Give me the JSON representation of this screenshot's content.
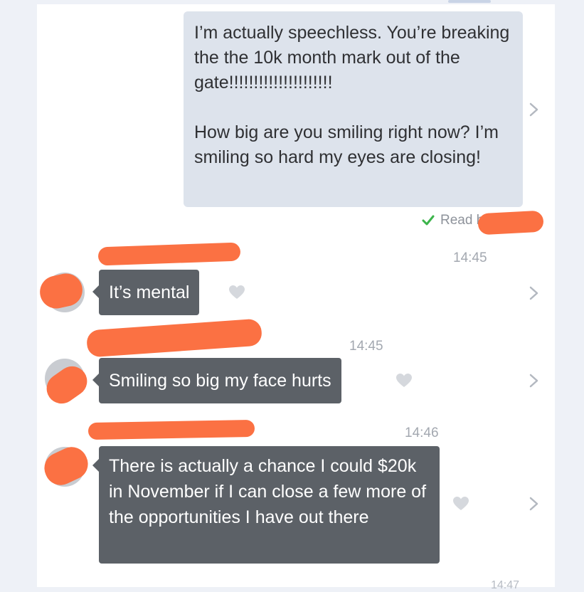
{
  "messages": {
    "outgoing": {
      "text": "I’m actually speechless. You’re breaking  the the 10k month mark out of the gate!!!!!!!!!!!!!!!!!!!!!\n\nHow big are you smiling right now? I’m smiling so hard my eyes are closing!",
      "status": "Read b"
    },
    "incoming": [
      {
        "time": "14:45",
        "text": "It’s mental"
      },
      {
        "time": "14:45",
        "text": "Smiling so big my face hurts"
      },
      {
        "time": "14:46",
        "text": "There is actually a chance I could $20k in November if I can close a few more of the opportunities I have out there"
      }
    ],
    "next_time": "14:47"
  },
  "colors": {
    "outgoing_bubble": "#dde3ec",
    "incoming_bubble": "#5c6167",
    "redaction": "#fb7143",
    "read_check": "#3cb44b"
  },
  "icons": {
    "read": "check-icon",
    "like": "heart-icon",
    "detail": "chevron-right-icon"
  }
}
